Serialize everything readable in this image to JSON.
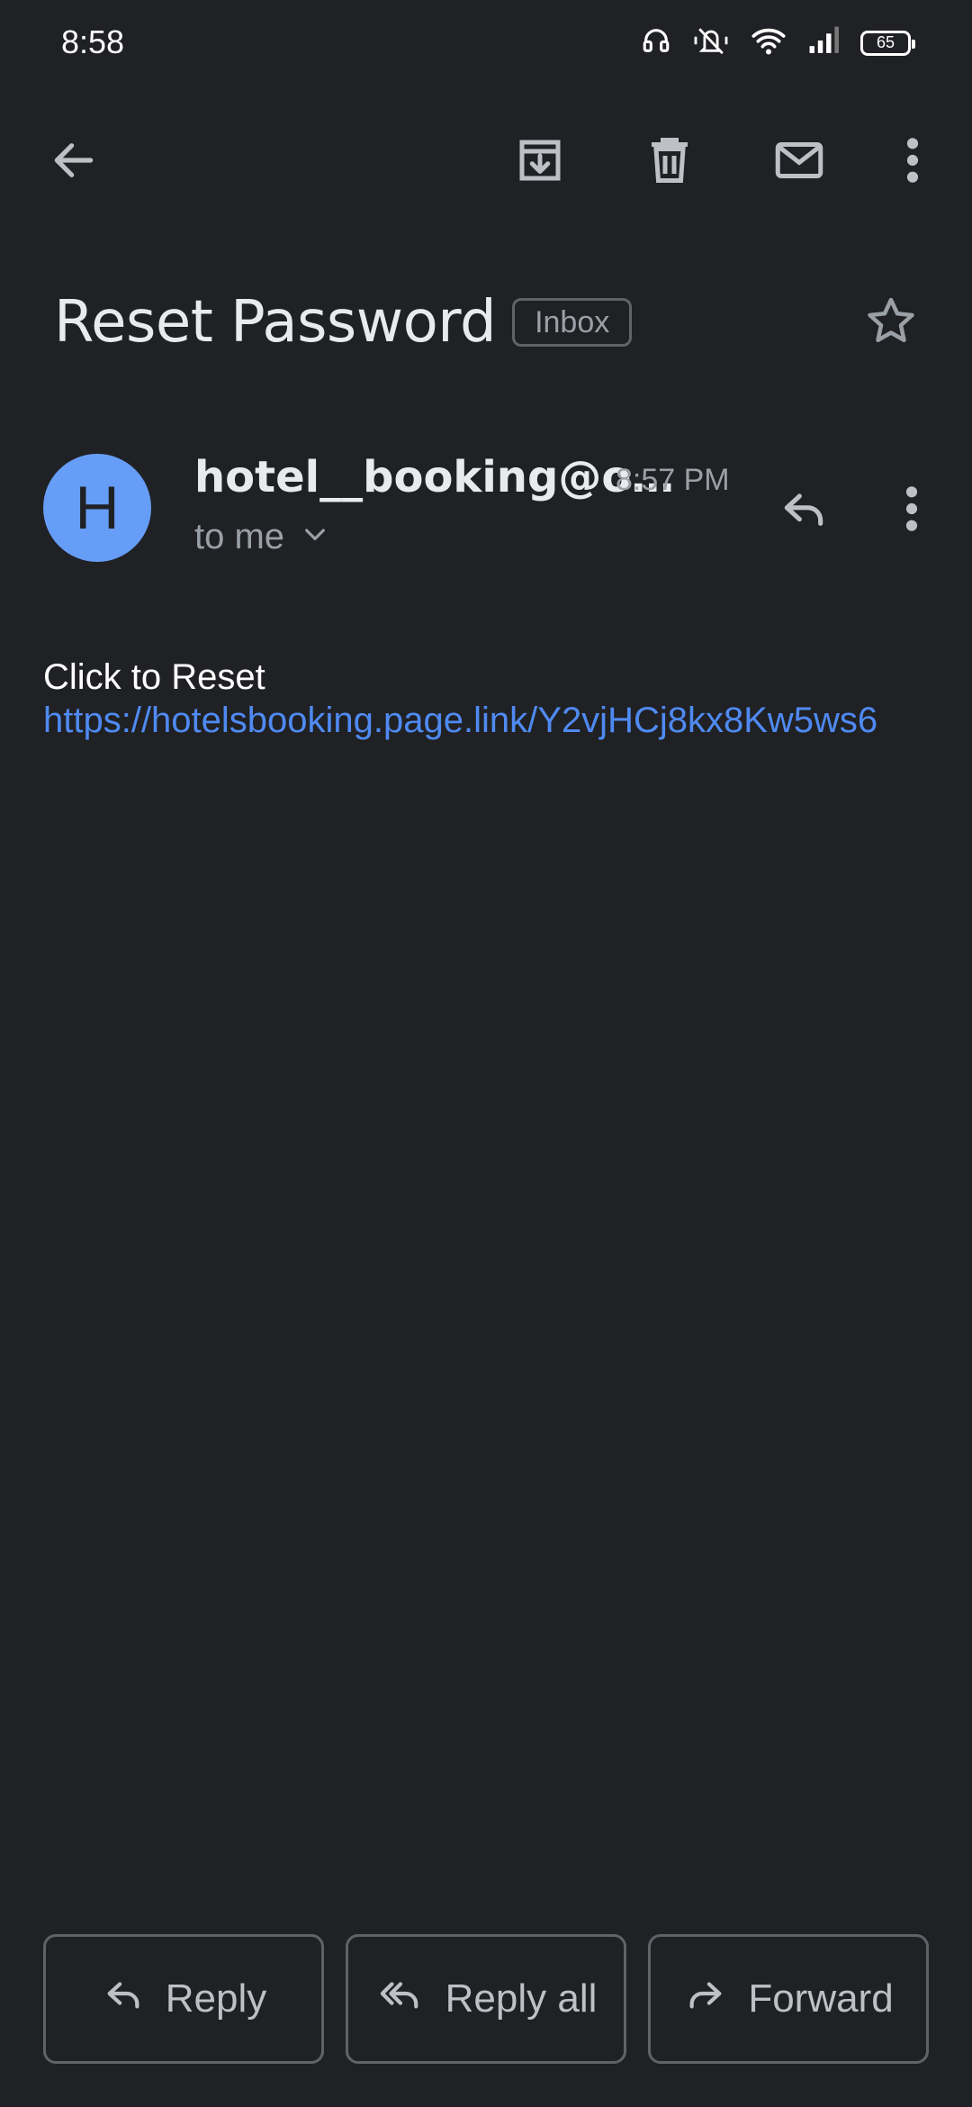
{
  "status_bar": {
    "time": "8:58",
    "battery": "65"
  },
  "toolbar": {
    "back": "arrow-back-icon",
    "archive": "archive-icon",
    "delete": "trash-icon",
    "mark_unread": "mail-icon",
    "more": "more-vert-icon"
  },
  "email": {
    "subject": "Reset Password",
    "label": "Inbox",
    "sender_initial": "H",
    "sender": "hotel__booking@o…",
    "time": "8:57 PM",
    "recipient": "to me",
    "body_line": "Click to Reset",
    "body_link": "https://hotelsbooking.page.link/Y2vjHCj8kx8Kw5ws6"
  },
  "actions": {
    "reply": "Reply",
    "reply_all": "Reply all",
    "forward": "Forward"
  },
  "colors": {
    "background": "#202124",
    "avatar": "#669df6",
    "link": "#4f8af2",
    "muted": "#9aa0a6"
  }
}
